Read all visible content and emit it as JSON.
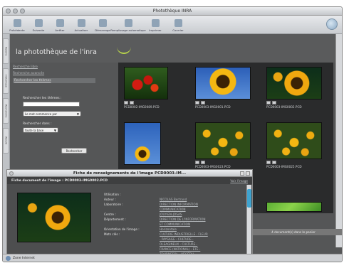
{
  "window": {
    "title": "Photothèque INRA"
  },
  "toolbar": {
    "items": [
      "Précédente",
      "Suivante",
      "Arrêter",
      "Actualiser",
      "Démarrage",
      "Remplissage automatique",
      "Imprimer",
      "Courrier"
    ]
  },
  "sidetabs": [
    "Favoris",
    "Historique",
    "Recherche",
    "Album"
  ],
  "banner": {
    "title": "la photothèque de l'inra"
  },
  "nav": {
    "links": [
      "Recherche libre",
      "Recherche avancée",
      "Rechercher les thèmes"
    ],
    "selected_index": 2
  },
  "search": {
    "theme_label": "Rechercher les thèmes :",
    "mode_value": "Le mot commence par",
    "where_label": "Rechercher dans :",
    "where_value": "toute la base",
    "submit_label": "Rechercher"
  },
  "gallery": [
    {
      "caption": "PCD0002-IMG0089.PCD",
      "kind": "tomato"
    },
    {
      "caption": "PCD0003-IMG0001.PCD",
      "kind": "sun-a"
    },
    {
      "caption": "PCD0003-IMG0002.PCD",
      "kind": "sun-b"
    },
    {
      "caption": "",
      "kind": "sun-tall"
    },
    {
      "caption": "PCD0003-IMG0023.PCD",
      "kind": "sun-field"
    },
    {
      "caption": "PCD0003-IMG0025.PCD",
      "kind": "sun-field"
    },
    {
      "caption": "PCD0003-IMG0025.PCD",
      "kind": "grass"
    }
  ],
  "cart": {
    "text": "4 document(s) dans le panier"
  },
  "detail": {
    "window_title": "Fiche de renseignements de l'image PCD0003-IM...",
    "heading": "Fiche document de l'image : PCD0003-IMG0002.PCD",
    "link": "Voir l'image",
    "fields": [
      {
        "k": "Utilisation :",
        "v": ""
      },
      {
        "k": "Auteur :",
        "v": "NICOLAS Bertrand"
      },
      {
        "k": "Laboratoire :",
        "v": "DIRECTION INFORMATION"
      },
      {
        "k": "",
        "v": "COMMUNICATION"
      },
      {
        "k": "Centre :",
        "v": "JOUY-EN-JOSAS"
      },
      {
        "k": "Département :",
        "v": "DIRECTION DE L'INFORMATION"
      },
      {
        "k": "",
        "v": "ET COMMUNICATION"
      },
      {
        "k": "Orientation de l'image :",
        "v": "Horizontale"
      },
      {
        "k": "Mots clés :",
        "v": "CULTURE INDUSTRIELLE - FLEUR"
      },
      {
        "k": "",
        "v": "- PAYSAGE - CULTURE -"
      },
      {
        "k": "",
        "v": "OLEAGINEUX - CULTURE -"
      },
      {
        "k": "",
        "v": "FRANCE (NATIONAL) - ÉTÉ -"
      },
      {
        "k": "",
        "v": "TOURNESOL - VÉGÉTAL - "
      }
    ]
  },
  "status": {
    "text": "Zone Internet"
  }
}
